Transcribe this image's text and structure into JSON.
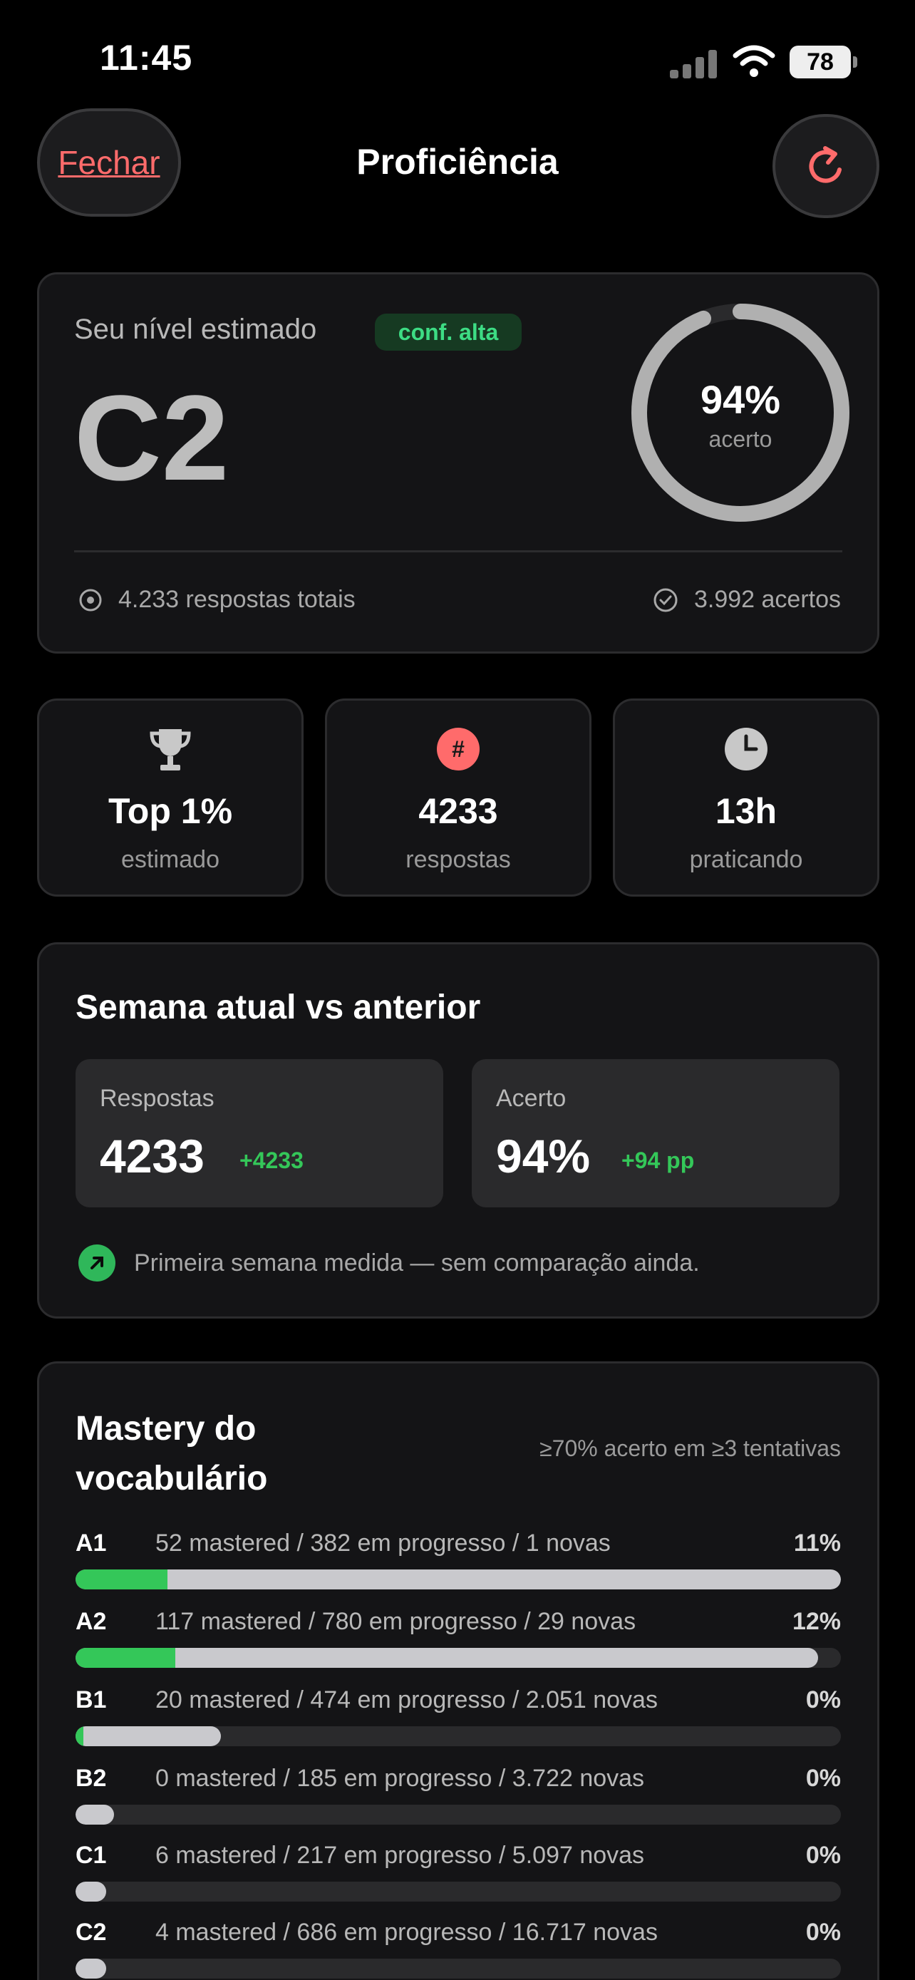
{
  "status": {
    "time": "11:45",
    "battery": "78"
  },
  "nav": {
    "close_label": "Fechar",
    "title": "Proficiência"
  },
  "level_card": {
    "label": "Seu nível estimado",
    "badge": "conf. alta",
    "level": "C2",
    "accuracy_value": "94%",
    "accuracy_label": "acerto",
    "accuracy_fraction": 0.94,
    "total_answers": "4.233 respostas totais",
    "total_correct": "3.992 acertos"
  },
  "stats": [
    {
      "icon": "trophy-icon",
      "value": "Top 1%",
      "label": "estimado"
    },
    {
      "icon": "hash-icon",
      "value": "4233",
      "label": "respostas"
    },
    {
      "icon": "clock-icon",
      "value": "13h",
      "label": "praticando"
    }
  ],
  "week": {
    "title": "Semana atual vs anterior",
    "answers": {
      "label": "Respostas",
      "value": "4233",
      "delta": "+4233"
    },
    "accuracy": {
      "label": "Acerto",
      "value": "94%",
      "delta": "+94 pp"
    },
    "note": "Primeira semana medida — sem comparação ainda."
  },
  "mastery": {
    "title": "Mastery do vocabulário",
    "subtitle": "≥70% acerto em ≥3 tentativas",
    "rows": [
      {
        "level": "A1",
        "desc": "52 mastered / 382 em progresso / 1 novas",
        "pct": "11%",
        "mastered": 0.12,
        "progress": 1.0
      },
      {
        "level": "A2",
        "desc": "117 mastered / 780 em progresso / 29 novas",
        "pct": "12%",
        "mastered": 0.13,
        "progress": 0.97
      },
      {
        "level": "B1",
        "desc": "20 mastered / 474 em progresso / 2.051 novas",
        "pct": "0%",
        "mastered": 0.01,
        "progress": 0.19
      },
      {
        "level": "B2",
        "desc": "0 mastered / 185 em progresso / 3.722 novas",
        "pct": "0%",
        "mastered": 0.0,
        "progress": 0.05
      },
      {
        "level": "C1",
        "desc": "6 mastered / 217 em progresso / 5.097 novas",
        "pct": "0%",
        "mastered": 0.0,
        "progress": 0.04
      },
      {
        "level": "C2",
        "desc": "4 mastered / 686 em progresso / 16.717 novas",
        "pct": "0%",
        "mastered": 0.0,
        "progress": 0.04
      }
    ]
  },
  "colors": {
    "accent_red": "#ff6b6b",
    "green": "#34c759",
    "ring_gray": "#b0b0b0"
  }
}
